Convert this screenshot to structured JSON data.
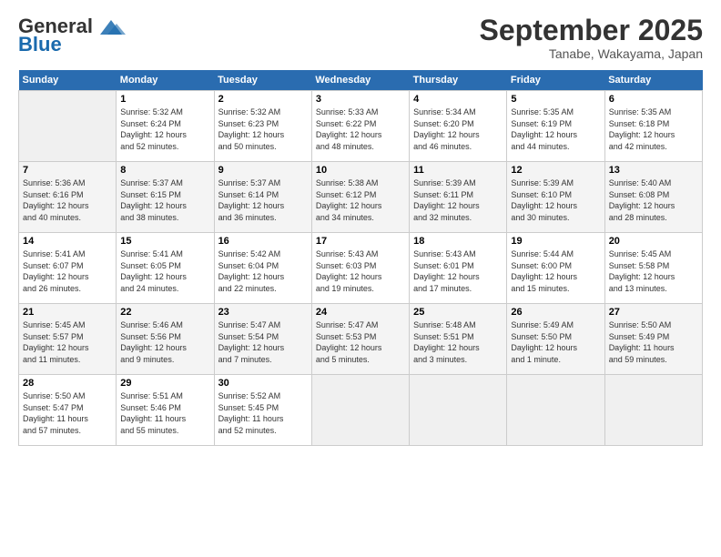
{
  "header": {
    "logo_general": "General",
    "logo_blue": "Blue",
    "month": "September 2025",
    "location": "Tanabe, Wakayama, Japan"
  },
  "weekdays": [
    "Sunday",
    "Monday",
    "Tuesday",
    "Wednesday",
    "Thursday",
    "Friday",
    "Saturday"
  ],
  "weeks": [
    [
      {
        "day": "",
        "info": ""
      },
      {
        "day": "1",
        "info": "Sunrise: 5:32 AM\nSunset: 6:24 PM\nDaylight: 12 hours\nand 52 minutes."
      },
      {
        "day": "2",
        "info": "Sunrise: 5:32 AM\nSunset: 6:23 PM\nDaylight: 12 hours\nand 50 minutes."
      },
      {
        "day": "3",
        "info": "Sunrise: 5:33 AM\nSunset: 6:22 PM\nDaylight: 12 hours\nand 48 minutes."
      },
      {
        "day": "4",
        "info": "Sunrise: 5:34 AM\nSunset: 6:20 PM\nDaylight: 12 hours\nand 46 minutes."
      },
      {
        "day": "5",
        "info": "Sunrise: 5:35 AM\nSunset: 6:19 PM\nDaylight: 12 hours\nand 44 minutes."
      },
      {
        "day": "6",
        "info": "Sunrise: 5:35 AM\nSunset: 6:18 PM\nDaylight: 12 hours\nand 42 minutes."
      }
    ],
    [
      {
        "day": "7",
        "info": "Sunrise: 5:36 AM\nSunset: 6:16 PM\nDaylight: 12 hours\nand 40 minutes."
      },
      {
        "day": "8",
        "info": "Sunrise: 5:37 AM\nSunset: 6:15 PM\nDaylight: 12 hours\nand 38 minutes."
      },
      {
        "day": "9",
        "info": "Sunrise: 5:37 AM\nSunset: 6:14 PM\nDaylight: 12 hours\nand 36 minutes."
      },
      {
        "day": "10",
        "info": "Sunrise: 5:38 AM\nSunset: 6:12 PM\nDaylight: 12 hours\nand 34 minutes."
      },
      {
        "day": "11",
        "info": "Sunrise: 5:39 AM\nSunset: 6:11 PM\nDaylight: 12 hours\nand 32 minutes."
      },
      {
        "day": "12",
        "info": "Sunrise: 5:39 AM\nSunset: 6:10 PM\nDaylight: 12 hours\nand 30 minutes."
      },
      {
        "day": "13",
        "info": "Sunrise: 5:40 AM\nSunset: 6:08 PM\nDaylight: 12 hours\nand 28 minutes."
      }
    ],
    [
      {
        "day": "14",
        "info": "Sunrise: 5:41 AM\nSunset: 6:07 PM\nDaylight: 12 hours\nand 26 minutes."
      },
      {
        "day": "15",
        "info": "Sunrise: 5:41 AM\nSunset: 6:05 PM\nDaylight: 12 hours\nand 24 minutes."
      },
      {
        "day": "16",
        "info": "Sunrise: 5:42 AM\nSunset: 6:04 PM\nDaylight: 12 hours\nand 22 minutes."
      },
      {
        "day": "17",
        "info": "Sunrise: 5:43 AM\nSunset: 6:03 PM\nDaylight: 12 hours\nand 19 minutes."
      },
      {
        "day": "18",
        "info": "Sunrise: 5:43 AM\nSunset: 6:01 PM\nDaylight: 12 hours\nand 17 minutes."
      },
      {
        "day": "19",
        "info": "Sunrise: 5:44 AM\nSunset: 6:00 PM\nDaylight: 12 hours\nand 15 minutes."
      },
      {
        "day": "20",
        "info": "Sunrise: 5:45 AM\nSunset: 5:58 PM\nDaylight: 12 hours\nand 13 minutes."
      }
    ],
    [
      {
        "day": "21",
        "info": "Sunrise: 5:45 AM\nSunset: 5:57 PM\nDaylight: 12 hours\nand 11 minutes."
      },
      {
        "day": "22",
        "info": "Sunrise: 5:46 AM\nSunset: 5:56 PM\nDaylight: 12 hours\nand 9 minutes."
      },
      {
        "day": "23",
        "info": "Sunrise: 5:47 AM\nSunset: 5:54 PM\nDaylight: 12 hours\nand 7 minutes."
      },
      {
        "day": "24",
        "info": "Sunrise: 5:47 AM\nSunset: 5:53 PM\nDaylight: 12 hours\nand 5 minutes."
      },
      {
        "day": "25",
        "info": "Sunrise: 5:48 AM\nSunset: 5:51 PM\nDaylight: 12 hours\nand 3 minutes."
      },
      {
        "day": "26",
        "info": "Sunrise: 5:49 AM\nSunset: 5:50 PM\nDaylight: 12 hours\nand 1 minute."
      },
      {
        "day": "27",
        "info": "Sunrise: 5:50 AM\nSunset: 5:49 PM\nDaylight: 11 hours\nand 59 minutes."
      }
    ],
    [
      {
        "day": "28",
        "info": "Sunrise: 5:50 AM\nSunset: 5:47 PM\nDaylight: 11 hours\nand 57 minutes."
      },
      {
        "day": "29",
        "info": "Sunrise: 5:51 AM\nSunset: 5:46 PM\nDaylight: 11 hours\nand 55 minutes."
      },
      {
        "day": "30",
        "info": "Sunrise: 5:52 AM\nSunset: 5:45 PM\nDaylight: 11 hours\nand 52 minutes."
      },
      {
        "day": "",
        "info": ""
      },
      {
        "day": "",
        "info": ""
      },
      {
        "day": "",
        "info": ""
      },
      {
        "day": "",
        "info": ""
      }
    ]
  ]
}
